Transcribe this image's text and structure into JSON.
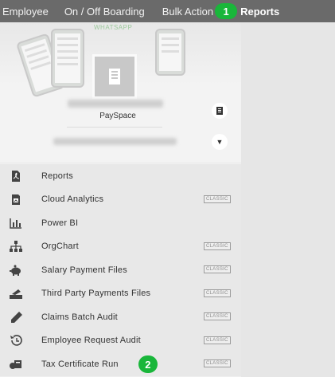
{
  "nav": {
    "tabs": [
      {
        "label": "Employee"
      },
      {
        "label": "On / Off Boarding"
      },
      {
        "label": "Bulk Action"
      },
      {
        "label": "Reports"
      }
    ],
    "step_badge": "1"
  },
  "profile": {
    "banner_label": "WHATSAPP",
    "company": "PaySpace"
  },
  "menu": {
    "items": [
      {
        "label": "Reports",
        "icon": "pdf-report-icon",
        "classic": ""
      },
      {
        "label": "Cloud Analytics",
        "icon": "cloud-analytics-icon",
        "classic": "CLASSIC"
      },
      {
        "label": "Power BI",
        "icon": "bar-chart-icon",
        "classic": ""
      },
      {
        "label": "OrgChart",
        "icon": "org-chart-icon",
        "classic": "CLASSIC"
      },
      {
        "label": "Salary Payment Files",
        "icon": "piggy-bank-icon",
        "classic": "CLASSIC"
      },
      {
        "label": "Third Party Payments Files",
        "icon": "payments-tray-icon",
        "classic": "CLASSIC"
      },
      {
        "label": "Claims Batch Audit",
        "icon": "pencil-icon",
        "classic": "CLASSIC"
      },
      {
        "label": "Employee Request Audit",
        "icon": "history-icon",
        "classic": "CLASSIC"
      },
      {
        "label": "Tax Certificate Run",
        "icon": "tax-certificate-icon",
        "classic": "CLASSIC"
      }
    ],
    "step_badge": "2"
  },
  "colors": {
    "nav_bg": "#6a6a6a",
    "badge": "#19b63a"
  }
}
